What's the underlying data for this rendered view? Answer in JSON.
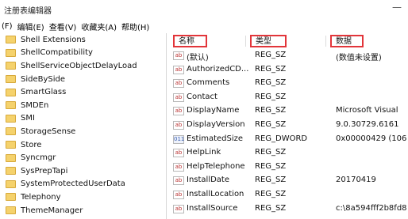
{
  "window": {
    "title": "注册表编辑器",
    "minimize_glyph": "—"
  },
  "menu": [
    "(F)",
    "编辑(E)",
    "查看(V)",
    "收藏夹(A)",
    "帮助(H)"
  ],
  "tree": {
    "items": [
      "Shell Extensions",
      "ShellCompatibility",
      "ShellServiceObjectDelayLoad",
      "SideBySide",
      "SmartGlass",
      "SMDEn",
      "SMI",
      "StorageSense",
      "Store",
      "Syncmgr",
      "SysPrepTapi",
      "SystemProtectedUserData",
      "Telephony",
      "ThemeManager"
    ]
  },
  "list": {
    "headers": {
      "name": "名称",
      "type": "类型",
      "data": "数据"
    },
    "rows": [
      {
        "icon": "ab",
        "name": "(默认)",
        "type": "REG_SZ",
        "data": "(数值未设置)"
      },
      {
        "icon": "ab",
        "name": "AuthorizedCD...",
        "type": "REG_SZ",
        "data": ""
      },
      {
        "icon": "ab",
        "name": "Comments",
        "type": "REG_SZ",
        "data": ""
      },
      {
        "icon": "ab",
        "name": "Contact",
        "type": "REG_SZ",
        "data": ""
      },
      {
        "icon": "ab",
        "name": "DisplayName",
        "type": "REG_SZ",
        "data": "Microsoft Visual"
      },
      {
        "icon": "ab",
        "name": "DisplayVersion",
        "type": "REG_SZ",
        "data": "9.0.30729.6161"
      },
      {
        "icon": "011",
        "name": "EstimatedSize",
        "type": "REG_DWORD",
        "data": "0x00000429 (106"
      },
      {
        "icon": "ab",
        "name": "HelpLink",
        "type": "REG_SZ",
        "data": ""
      },
      {
        "icon": "ab",
        "name": "HelpTelephone",
        "type": "REG_SZ",
        "data": ""
      },
      {
        "icon": "ab",
        "name": "InstallDate",
        "type": "REG_SZ",
        "data": "20170419"
      },
      {
        "icon": "ab",
        "name": "InstallLocation",
        "type": "REG_SZ",
        "data": ""
      },
      {
        "icon": "ab",
        "name": "InstallSource",
        "type": "REG_SZ",
        "data": "c:\\8a594fff2b8fd8"
      }
    ]
  },
  "colors": {
    "highlight_box": "#e2353a",
    "folder": "#f5d26c"
  }
}
